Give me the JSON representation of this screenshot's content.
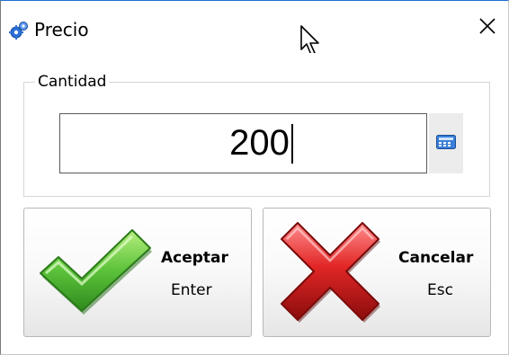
{
  "window": {
    "title": "Precio",
    "close_glyph": "✕"
  },
  "icons": {
    "app": "gears-icon",
    "cursor": "mouse-pointer-icon",
    "calculator": "calculator-icon",
    "accept": "checkmark-icon",
    "cancel": "red-x-icon"
  },
  "group": {
    "label": "Cantidad"
  },
  "quantity": {
    "value": "200"
  },
  "buttons": {
    "accept": {
      "label": "Aceptar",
      "shortcut": "Enter"
    },
    "cancel": {
      "label": "Cancelar",
      "shortcut": "Esc"
    }
  },
  "colors": {
    "accept_green": "#5cc23a",
    "cancel_red": "#d01a1a",
    "title_border": "#1f6fd0"
  }
}
